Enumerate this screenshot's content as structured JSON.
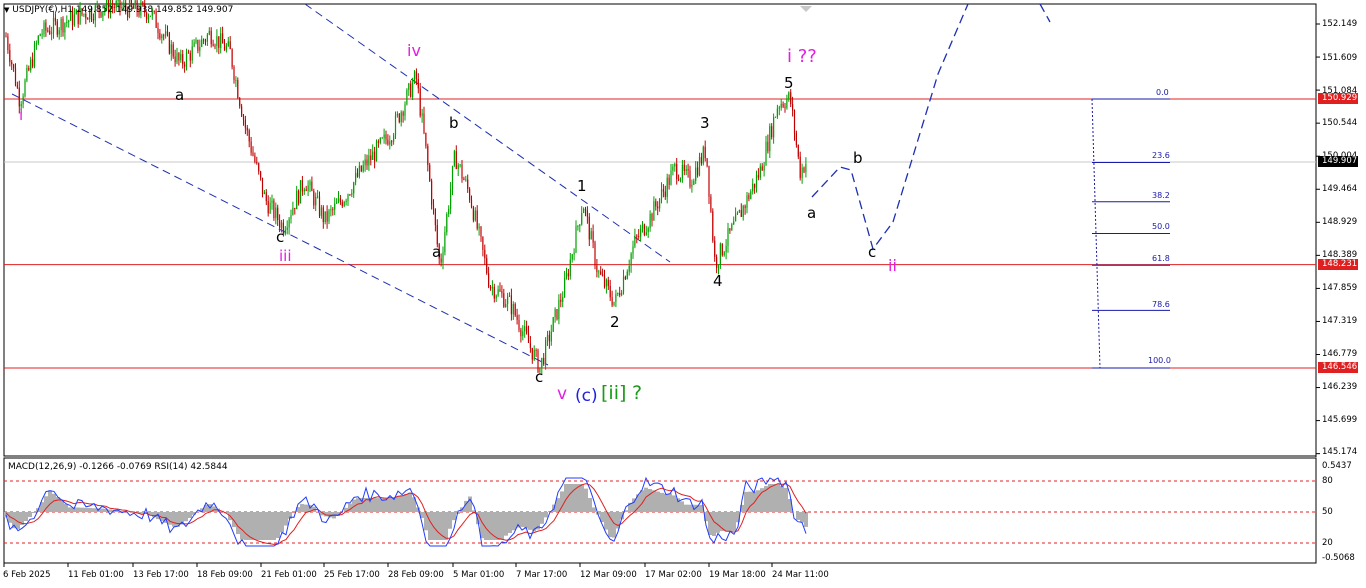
{
  "window": {
    "header": "USDJPY(€),H1 149.852 149.938 149.852 149.907",
    "indicator_header": "MACD(12,26,9) -0.1266 -0.0769 RSI(14) 42.5844"
  },
  "colors": {
    "bull": "#00a000",
    "bear": "#c00000",
    "hline": "#e02020",
    "trend": "#1e2fb0",
    "fib": "#1a1aa8",
    "pink": "#e020e0",
    "green": "#1a9a1a",
    "blue": "#2020e0",
    "macd_line": "#1f3cff",
    "signal_line": "#e02020",
    "hist": "#b0b0b0"
  },
  "chart_data": [
    {
      "type": "candlestick",
      "title": "USDJPY(€),H1",
      "ylim": [
        145.0,
        152.5
      ],
      "y_ticks": [
        "152.149",
        "151.609",
        "151.084",
        "150.544",
        "150.004",
        "149.464",
        "148.929",
        "148.389",
        "147.859",
        "147.319",
        "146.779",
        "146.239",
        "145.699",
        "145.174"
      ],
      "x_ticks": [
        "6 Feb 2025",
        "11 Feb 01:00",
        "13 Feb 17:00",
        "18 Feb 09:00",
        "21 Feb 01:00",
        "25 Feb 17:00",
        "28 Feb 09:00",
        "5 Mar 01:00",
        "7 Mar 17:00",
        "12 Mar 09:00",
        "17 Mar 02:00",
        "19 Mar 18:00",
        "24 Mar 11:00"
      ],
      "price_path": [
        [
          0,
          152.4
        ],
        [
          20,
          150.9
        ],
        [
          40,
          152.0
        ],
        [
          80,
          152.3
        ],
        [
          110,
          152.45
        ],
        [
          150,
          152.35
        ],
        [
          180,
          151.5
        ],
        [
          210,
          152.0
        ],
        [
          230,
          151.7
        ],
        [
          245,
          150.5
        ],
        [
          265,
          149.3
        ],
        [
          283,
          148.85
        ],
        [
          305,
          149.6
        ],
        [
          325,
          148.95
        ],
        [
          345,
          149.35
        ],
        [
          365,
          149.85
        ],
        [
          392,
          150.4
        ],
        [
          416,
          151.3
        ],
        [
          425,
          150.2
        ],
        [
          440,
          148.2
        ],
        [
          455,
          150.0
        ],
        [
          470,
          149.35
        ],
        [
          490,
          147.9
        ],
        [
          510,
          147.6
        ],
        [
          540,
          146.55
        ],
        [
          565,
          147.9
        ],
        [
          583,
          149.25
        ],
        [
          598,
          148.1
        ],
        [
          615,
          147.6
        ],
        [
          635,
          148.6
        ],
        [
          650,
          149.0
        ],
        [
          675,
          149.8
        ],
        [
          690,
          149.6
        ],
        [
          706,
          150.1
        ],
        [
          715,
          148.25
        ],
        [
          740,
          149.05
        ],
        [
          760,
          149.75
        ],
        [
          778,
          150.85
        ],
        [
          790,
          150.95
        ],
        [
          800,
          149.75
        ],
        [
          806,
          149.9
        ]
      ],
      "price_labels": {
        "current": "149.907",
        "top_line": "150.929",
        "mid_line": "148.231",
        "bottom_line": "146.546"
      },
      "horizontal_lines": [
        150.929,
        148.231,
        146.546
      ],
      "fibonacci": {
        "levels": [
          "0.0",
          "23.6",
          "38.2",
          "50.0",
          "61.8",
          "78.6",
          "100.0"
        ],
        "high": 150.929,
        "low": 146.546
      },
      "wave_labels": {
        "i_left": "i",
        "a1": "a",
        "c1": "c",
        "iii": "iii",
        "iv": "iv",
        "b2": "b",
        "a2": "a",
        "c2": "c",
        "v": "v",
        "c_paren": "(c)",
        "ii_bracket": "[ii]",
        "question": "?",
        "w1": "1",
        "w2": "2",
        "w3": "3",
        "w4": "4",
        "w5": "5",
        "i_q": "i ??",
        "proj_a": "a",
        "proj_b": "b",
        "proj_c": "c",
        "proj_ii": "ii"
      }
    },
    {
      "type": "line",
      "title": "MACD(12,26,9) RSI(14)",
      "macd_value": -0.1266,
      "signal_value": -0.0769,
      "rsi_value": 42.5844,
      "y_ticks": [
        "0.5437",
        "80",
        "50",
        "20",
        "-0.5068"
      ],
      "rsi_levels": [
        80,
        50,
        20
      ]
    }
  ]
}
